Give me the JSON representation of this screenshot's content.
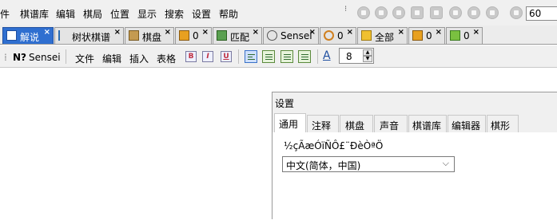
{
  "menu": [
    "件",
    "棋谱库",
    "编辑",
    "棋局",
    "位置",
    "显示",
    "搜索",
    "设置",
    "帮助"
  ],
  "nav": {
    "page_value": "60"
  },
  "tabs": [
    {
      "label": "解说",
      "close": "×"
    },
    {
      "label": "树状棋谱",
      "close": "×"
    },
    {
      "label": "棋盘",
      "close": "×"
    },
    {
      "label": "0",
      "close": "×"
    },
    {
      "label": "匹配",
      "close": "×"
    },
    {
      "label": "Sensei",
      "close": "×"
    },
    {
      "label": "0",
      "close": "×"
    },
    {
      "label": "全部",
      "close": "×"
    },
    {
      "label": "0",
      "close": "×"
    },
    {
      "label": "0",
      "close": "×"
    }
  ],
  "toolbar": {
    "sensei_label": "Sensei",
    "file_label": "文件",
    "edit_label": "编辑",
    "insert_label": "插入",
    "table_label": "表格",
    "bold": "B",
    "italic": "I",
    "underline": "U",
    "font_size": "8"
  },
  "dialog": {
    "title": "设置",
    "tabs": [
      "通用",
      "注释",
      "棋盘",
      "声音",
      "棋谱库",
      "编辑器",
      "棋形"
    ],
    "language_label": "½çÃæÓïÑÔ£¨ÐèÒªÖ",
    "language_value": "中文(简体，中国)",
    "chevron": "⌵"
  },
  "colors": {
    "active_tab": "#2f6fd0",
    "dialog_bg": "#f0f0f0"
  }
}
